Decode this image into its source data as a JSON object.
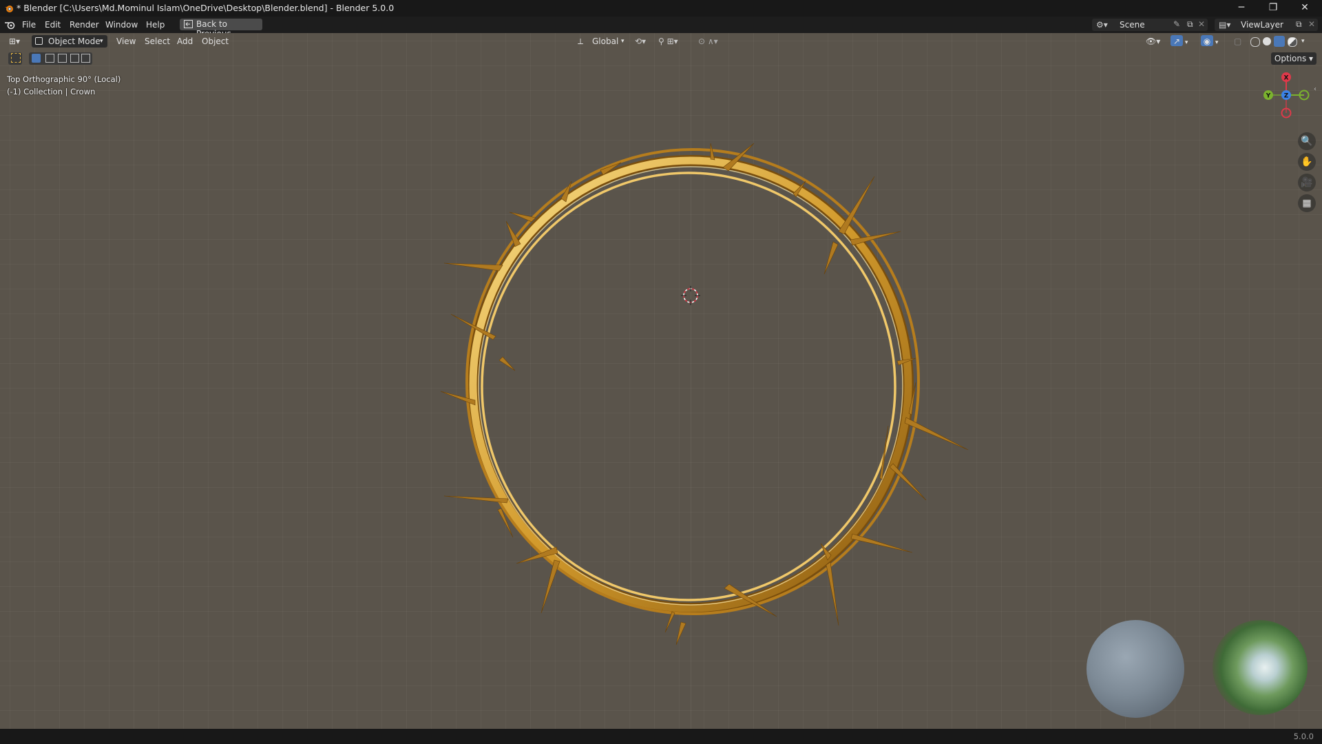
{
  "window": {
    "title": "* Blender [C:\\Users\\Md.Mominul Islam\\OneDrive\\Desktop\\Blender.blend] - Blender 5.0.0",
    "minimize": "─",
    "maximize": "❐",
    "close": "✕"
  },
  "topbar": {
    "menus": [
      "File",
      "Edit",
      "Render",
      "Window",
      "Help"
    ],
    "back_button": "Back to Previous",
    "scene_label": "Scene",
    "view_layer_label": "ViewLayer"
  },
  "viewport_header": {
    "mode": "Object Mode",
    "menus": [
      "View",
      "Select",
      "Add",
      "Object"
    ],
    "transform_orientation": "Global",
    "options_label": "Options"
  },
  "viewport_overlay": {
    "view_name": "Top Orthographic 90° (Local)",
    "collection_info": "(-1) Collection | Crown"
  },
  "gizmo": {
    "x_label": "X",
    "y_label": "Y",
    "z_label": "Z"
  },
  "colors": {
    "viewport_bg": "#5a544b",
    "axis_x": "#e0394a",
    "axis_y": "#7bb32e",
    "axis_z": "#3b82e6",
    "gold": "#d9a030"
  },
  "statusbar": {
    "version": "5.0.0"
  }
}
